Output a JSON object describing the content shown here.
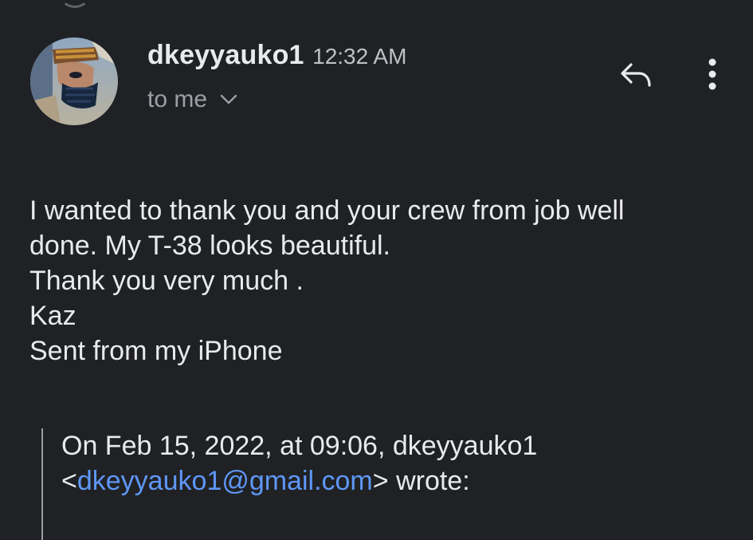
{
  "message": {
    "sender_name": "dkeyyauko1",
    "time": "12:32 AM",
    "recipient_label": "to me",
    "body_lines": [
      "I wanted to thank you and your crew from job well",
      "done. My T-38 looks beautiful.",
      "Thank you very much .",
      "Kaz",
      "Sent from my iPhone"
    ]
  },
  "quoted": {
    "line1": "On Feb 15, 2022, at 09:06, dkeyyauko1",
    "open_bracket": "<",
    "email": "dkeyyauko1@gmail.com",
    "after_email": "> wrote:"
  },
  "icons": {
    "avatar": "avatar-image",
    "recipient_toggle": "chevron-down-icon",
    "reply": "reply-icon",
    "more": "more-vert-icon"
  },
  "colors": {
    "background": "#202124",
    "text": "#e8eaed",
    "secondary_text": "#9aa0a6",
    "link": "#5e97f6"
  }
}
